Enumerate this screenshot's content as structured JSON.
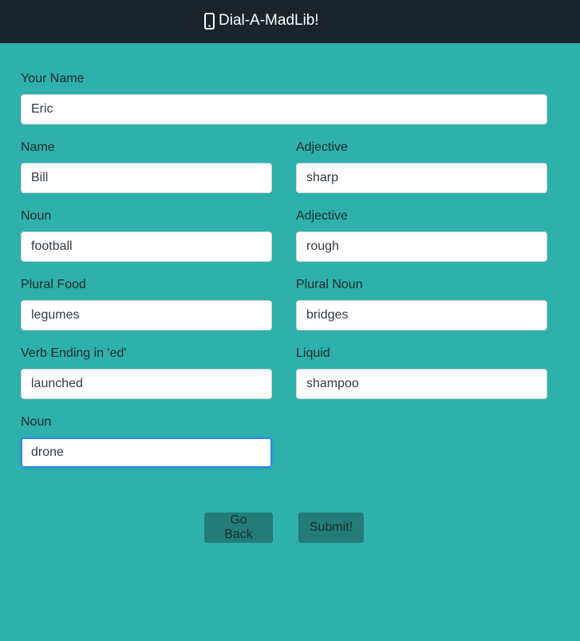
{
  "header": {
    "title": "Dial-A-MadLib!",
    "icon": "mobile-phone-icon"
  },
  "form": {
    "your_name": {
      "label": "Your Name",
      "value": "Eric"
    },
    "name": {
      "label": "Name",
      "value": "Bill"
    },
    "adjective_1": {
      "label": "Adjective",
      "value": "sharp"
    },
    "noun_1": {
      "label": "Noun",
      "value": "football"
    },
    "adjective_2": {
      "label": "Adjective",
      "value": "rough"
    },
    "plural_food": {
      "label": "Plural Food",
      "value": "legumes"
    },
    "plural_noun": {
      "label": "Plural Noun",
      "value": "bridges"
    },
    "verb_ed": {
      "label": "Verb Ending in 'ed'",
      "value": "launched"
    },
    "liquid": {
      "label": "Liquid",
      "value": "shampoo"
    },
    "noun_2": {
      "label": "Noun",
      "value": "drone"
    }
  },
  "actions": {
    "back_label": "Go Back",
    "submit_label": "Submit!"
  },
  "colors": {
    "page_bg": "#2eb1aa",
    "navbar_bg": "#1a242a",
    "button_bg": "#247c78",
    "focus_border": "#2f8ae3"
  }
}
